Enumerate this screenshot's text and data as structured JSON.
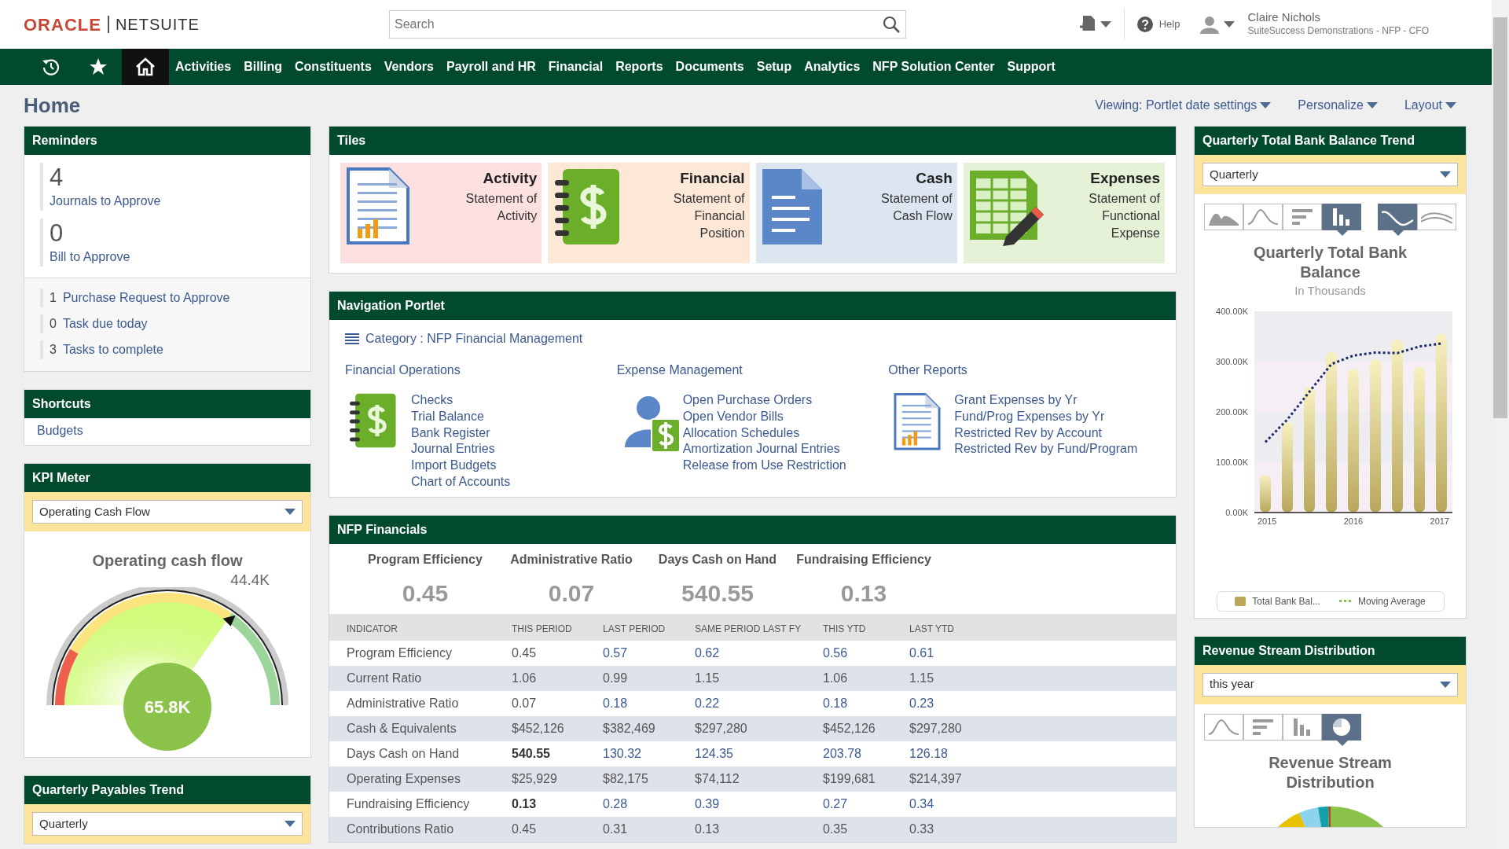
{
  "header": {
    "brand": "ORACLE",
    "product": "NETSUITE",
    "search": {
      "placeholder": "Search"
    },
    "help": "Help",
    "user": {
      "name": "Claire Nichols",
      "role": "SuiteSuccess Demonstrations - NFP - CFO"
    }
  },
  "nav": {
    "icon_tabs": [
      {
        "kind": "recent",
        "selected": false
      },
      {
        "kind": "favorites",
        "selected": false
      },
      {
        "kind": "home",
        "selected": true
      }
    ],
    "items": [
      "Activities",
      "Billing",
      "Constituents",
      "Vendors",
      "Payroll and HR",
      "Financial",
      "Reports",
      "Documents",
      "Setup",
      "Analytics",
      "NFP Solution Center",
      "Support"
    ]
  },
  "page": {
    "title": "Home",
    "menus": [
      "Viewing: Portlet date settings",
      "Personalize",
      "Layout"
    ]
  },
  "reminders": {
    "title": "Reminders",
    "big": [
      {
        "count": "4",
        "label": "Journals to Approve"
      },
      {
        "count": "0",
        "label": "Bill to Approve"
      }
    ],
    "small": [
      {
        "count": "1",
        "label": "Purchase Request to Approve"
      },
      {
        "count": "0",
        "label": "Task due today"
      },
      {
        "count": "3",
        "label": "Tasks to complete"
      }
    ]
  },
  "shortcuts": {
    "title": "Shortcuts",
    "items": [
      "Budgets"
    ]
  },
  "kpi_meter": {
    "title": "KPI Meter",
    "select": "Operating Cash Flow",
    "gauge_title": "Operating cash flow",
    "target": "44.4K",
    "value": "65.8K"
  },
  "payables_trend": {
    "title": "Quarterly Payables Trend",
    "select": "Quarterly"
  },
  "tiles": {
    "title": "Tiles",
    "items": [
      {
        "kind": "activity",
        "title": "Activity",
        "subtitle": "Statement of Activity",
        "color": "#fde0e0"
      },
      {
        "kind": "financial",
        "title": "Financial",
        "subtitle": "Statement of Financial Position",
        "color": "#fde8d8"
      },
      {
        "kind": "cash",
        "title": "Cash",
        "subtitle": "Statement of Cash Flow",
        "color": "#dce6f1"
      },
      {
        "kind": "expenses",
        "title": "Expenses",
        "subtitle": "Statement of Functional Expense",
        "color": "#e6f2d8"
      }
    ]
  },
  "navigation": {
    "title": "Navigation Portlet",
    "category": "Category : NFP Financial Management",
    "groups": [
      {
        "kind": "ledger",
        "title": "Financial Operations",
        "links": [
          "Checks",
          "Trial Balance",
          "Bank Register",
          "Journal Entries",
          "Import Budgets",
          "Chart of Accounts"
        ]
      },
      {
        "kind": "payee",
        "title": "Expense Management",
        "links": [
          "Open Purchase Orders",
          "Open Vendor Bills",
          "Allocation Schedules",
          "Amortization Journal Entries",
          "Release from Use Restriction"
        ]
      },
      {
        "kind": "report",
        "title": "Other Reports",
        "links": [
          "Grant Expenses by Yr",
          "Fund/Prog Expenses by Yr",
          "Restricted Rev by Account",
          "Restricted Rev by Fund/Program"
        ]
      }
    ]
  },
  "nfp_financials": {
    "title": "NFP Financials",
    "kpis": [
      {
        "label": "Program Efficiency",
        "value": "0.45"
      },
      {
        "label": "Administrative Ratio",
        "value": "0.07"
      },
      {
        "label": "Days Cash on Hand",
        "value": "540.55"
      },
      {
        "label": "Fundraising Efficiency",
        "value": "0.13"
      }
    ],
    "columns": [
      "INDICATOR",
      "THIS PERIOD",
      "LAST PERIOD",
      "SAME PERIOD LAST FY",
      "THIS YTD",
      "LAST YTD"
    ],
    "rows": [
      {
        "indicator": "Program Efficiency",
        "values": [
          "0.45",
          "0.57",
          "0.62",
          "0.56",
          "0.61"
        ],
        "linked": true,
        "emphasis": false
      },
      {
        "indicator": "Current Ratio",
        "values": [
          "1.06",
          "0.99",
          "1.15",
          "1.06",
          "1.15"
        ],
        "linked": false,
        "emphasis": false
      },
      {
        "indicator": "Administrative Ratio",
        "values": [
          "0.07",
          "0.18",
          "0.22",
          "0.18",
          "0.23"
        ],
        "linked": true,
        "emphasis": false
      },
      {
        "indicator": "Cash & Equivalents",
        "values": [
          "$452,126",
          "$382,469",
          "$297,280",
          "$452,126",
          "$297,280"
        ],
        "linked": false,
        "emphasis": false
      },
      {
        "indicator": "Days Cash on Hand",
        "values": [
          "540.55",
          "130.32",
          "124.35",
          "203.78",
          "126.18"
        ],
        "linked": true,
        "emphasis": true
      },
      {
        "indicator": "Operating Expenses",
        "values": [
          "$25,929",
          "$82,175",
          "$74,112",
          "$199,681",
          "$214,397"
        ],
        "linked": false,
        "emphasis": false
      },
      {
        "indicator": "Fundraising Efficiency",
        "values": [
          "0.13",
          "0.28",
          "0.39",
          "0.27",
          "0.34"
        ],
        "linked": true,
        "emphasis": true
      },
      {
        "indicator": "Contributions Ratio",
        "values": [
          "0.45",
          "0.31",
          "0.13",
          "0.35",
          "0.33"
        ],
        "linked": false,
        "emphasis": false
      }
    ]
  },
  "bank_balance_trend": {
    "title": "Quarterly Total Bank Balance Trend",
    "select": "Quarterly",
    "chart_types": [
      {
        "kind": "area",
        "selected": false
      },
      {
        "kind": "line",
        "selected": false
      },
      {
        "kind": "hbar",
        "selected": false
      },
      {
        "kind": "column",
        "selected": true
      }
    ],
    "line_styles": [
      {
        "kind": "spline",
        "selected": true
      },
      {
        "kind": "straight",
        "selected": false
      }
    ],
    "chart_data": {
      "type": "bar",
      "title": "Quarterly Total Bank Balance",
      "subtitle": "In Thousands",
      "x": [
        2015,
        2015.25,
        2015.5,
        2015.75,
        2016,
        2016.25,
        2016.5,
        2016.75,
        2017
      ],
      "xlim": [
        2014.875,
        2017.125
      ],
      "xticks": [
        2015,
        2016,
        2017
      ],
      "ylim": [
        0,
        400000
      ],
      "yticks": [
        {
          "value": 0,
          "label": "0.00K"
        },
        {
          "value": 100000,
          "label": "100.00K"
        },
        {
          "value": 200000,
          "label": "200.00K"
        },
        {
          "value": 300000,
          "label": "300.00K"
        },
        {
          "value": 400000,
          "label": "400.00K"
        }
      ],
      "series": [
        {
          "name": "Total Bank Bal...",
          "type": "bar",
          "color": "#b9a85a",
          "values": [
            75000,
            180000,
            250000,
            320000,
            285000,
            305000,
            345000,
            290000,
            355000
          ]
        },
        {
          "name": "Moving Average",
          "type": "line",
          "line_style": "dotted",
          "color": "#1b2a6b",
          "values": [
            140000,
            185000,
            240000,
            295000,
            312000,
            318000,
            317000,
            330000,
            336000
          ]
        }
      ]
    }
  },
  "revenue_distribution": {
    "title": "Revenue Stream Distribution",
    "select": "this year",
    "chart_types": [
      {
        "kind": "line",
        "selected": false
      },
      {
        "kind": "hbar",
        "selected": false
      },
      {
        "kind": "column",
        "selected": false
      },
      {
        "kind": "pie",
        "selected": true
      }
    ],
    "chart_title": "Revenue Stream Distribution"
  }
}
